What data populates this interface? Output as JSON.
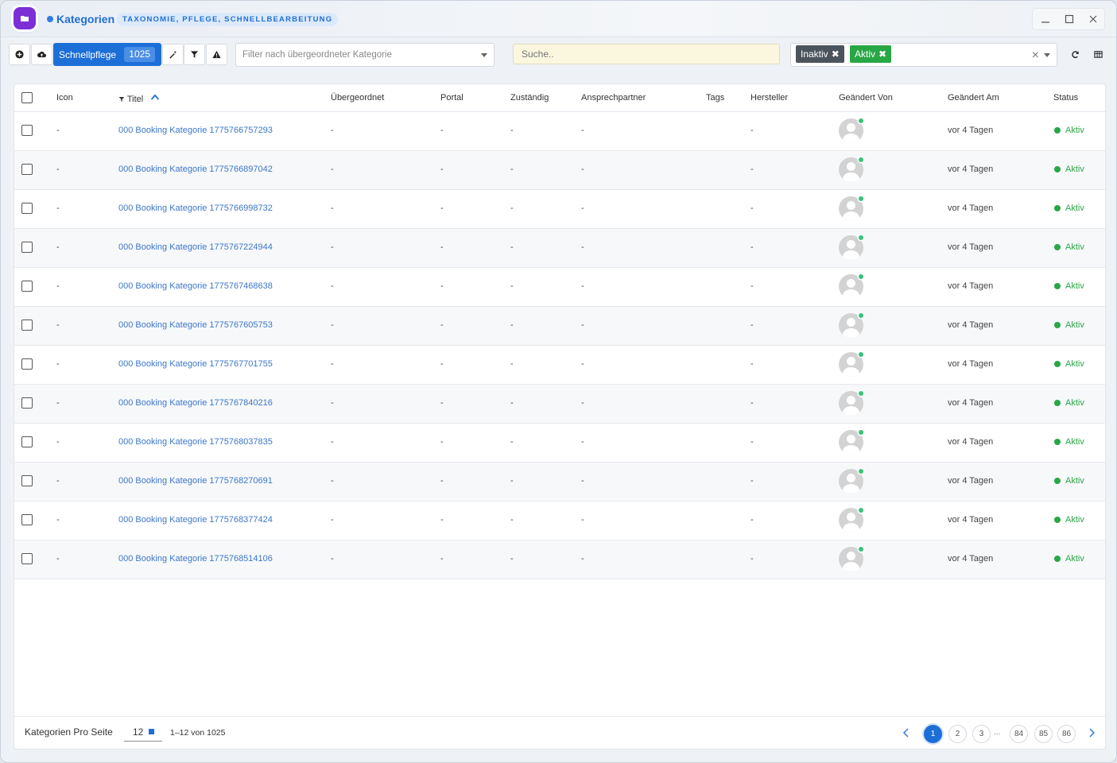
{
  "window": {
    "title": "Kategorien",
    "subtitle": "TAXONOMIE, PFLEGE, SCHNELLBEARBEITUNG",
    "controls": [
      "minimize-icon",
      "maximize-icon",
      "close-icon"
    ]
  },
  "toolbar": {
    "add_icon": "plus-circle-icon",
    "upload_icon": "cloud-upload-icon",
    "quick_edit_label": "Schnellpflege",
    "quick_edit_count": "1025",
    "magic_icon": "magic-wand-icon",
    "filter_icon": "filter-icon",
    "warning_icon": "warning-icon",
    "parent_filter_placeholder": "Filter nach übergeordneter Kategorie",
    "search_placeholder": "Suche..",
    "status_chips": [
      {
        "label": "Inaktiv",
        "color": "#4b535c"
      },
      {
        "label": "Aktiv",
        "color": "#28a745"
      }
    ],
    "refresh_icon": "refresh-icon",
    "columns_icon": "table-columns-icon"
  },
  "table": {
    "columns": [
      "Icon",
      "Titel",
      "Übergeordnet",
      "Portal",
      "Zuständig",
      "Ansprechpartner",
      "Tags",
      "Hersteller",
      "Geändert Von",
      "Geändert Am",
      "Status"
    ],
    "sort_column": "Titel",
    "rows": [
      {
        "icon": "-",
        "title": "000 Booking Kategorie 1775766757293",
        "parent": "-",
        "portal": "-",
        "responsible": "-",
        "contact": "-",
        "tags": "",
        "manufacturer": "-",
        "changed_at": "vor 4 Tagen",
        "status": "Aktiv"
      },
      {
        "icon": "-",
        "title": "000 Booking Kategorie 1775766897042",
        "parent": "-",
        "portal": "-",
        "responsible": "-",
        "contact": "-",
        "tags": "",
        "manufacturer": "-",
        "changed_at": "vor 4 Tagen",
        "status": "Aktiv"
      },
      {
        "icon": "-",
        "title": "000 Booking Kategorie 1775766998732",
        "parent": "-",
        "portal": "-",
        "responsible": "-",
        "contact": "-",
        "tags": "",
        "manufacturer": "-",
        "changed_at": "vor 4 Tagen",
        "status": "Aktiv"
      },
      {
        "icon": "-",
        "title": "000 Booking Kategorie 1775767224944",
        "parent": "-",
        "portal": "-",
        "responsible": "-",
        "contact": "-",
        "tags": "",
        "manufacturer": "-",
        "changed_at": "vor 4 Tagen",
        "status": "Aktiv"
      },
      {
        "icon": "-",
        "title": "000 Booking Kategorie 1775767468638",
        "parent": "-",
        "portal": "-",
        "responsible": "-",
        "contact": "-",
        "tags": "",
        "manufacturer": "-",
        "changed_at": "vor 4 Tagen",
        "status": "Aktiv"
      },
      {
        "icon": "-",
        "title": "000 Booking Kategorie 1775767605753",
        "parent": "-",
        "portal": "-",
        "responsible": "-",
        "contact": "-",
        "tags": "",
        "manufacturer": "-",
        "changed_at": "vor 4 Tagen",
        "status": "Aktiv"
      },
      {
        "icon": "-",
        "title": "000 Booking Kategorie 1775767701755",
        "parent": "-",
        "portal": "-",
        "responsible": "-",
        "contact": "-",
        "tags": "",
        "manufacturer": "-",
        "changed_at": "vor 4 Tagen",
        "status": "Aktiv"
      },
      {
        "icon": "-",
        "title": "000 Booking Kategorie 1775767840216",
        "parent": "-",
        "portal": "-",
        "responsible": "-",
        "contact": "-",
        "tags": "",
        "manufacturer": "-",
        "changed_at": "vor 4 Tagen",
        "status": "Aktiv"
      },
      {
        "icon": "-",
        "title": "000 Booking Kategorie 1775768037835",
        "parent": "-",
        "portal": "-",
        "responsible": "-",
        "contact": "-",
        "tags": "",
        "manufacturer": "-",
        "changed_at": "vor 4 Tagen",
        "status": "Aktiv"
      },
      {
        "icon": "-",
        "title": "000 Booking Kategorie 1775768270691",
        "parent": "-",
        "portal": "-",
        "responsible": "-",
        "contact": "-",
        "tags": "",
        "manufacturer": "-",
        "changed_at": "vor 4 Tagen",
        "status": "Aktiv"
      },
      {
        "icon": "-",
        "title": "000 Booking Kategorie 1775768377424",
        "parent": "-",
        "portal": "-",
        "responsible": "-",
        "contact": "-",
        "tags": "",
        "manufacturer": "-",
        "changed_at": "vor 4 Tagen",
        "status": "Aktiv"
      },
      {
        "icon": "-",
        "title": "000 Booking Kategorie 1775768514106",
        "parent": "-",
        "portal": "-",
        "responsible": "-",
        "contact": "-",
        "tags": "",
        "manufacturer": "-",
        "changed_at": "vor 4 Tagen",
        "status": "Aktiv"
      }
    ]
  },
  "footer": {
    "per_page_label": "Kategorien Pro Seite",
    "per_page_value": "12",
    "range_text": "1–12 von 1025",
    "pages": [
      "1",
      "2",
      "3",
      "...",
      "84",
      "85",
      "86"
    ],
    "current_page": "1"
  },
  "colors": {
    "accent": "#1d6fd8",
    "app_icon": "#7b2fd6",
    "status_active": "#28a745",
    "search_bg": "#fbf7df"
  }
}
